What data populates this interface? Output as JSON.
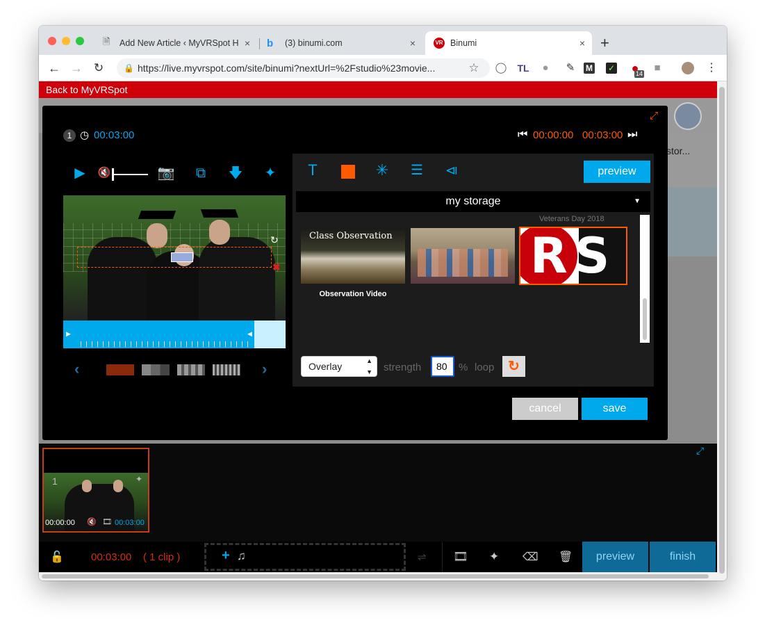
{
  "browser": {
    "tabs": [
      {
        "title": "Add New Article ‹ MyVRSpot H",
        "favicon": "document-icon"
      },
      {
        "title": "(3) binumi.com",
        "favicon": "binumi-b-icon"
      },
      {
        "title": "Binumi",
        "favicon": "vr-logo-icon"
      }
    ],
    "new_tab_label": "+",
    "url": "https://live.myvrspot.com/site/binumi?nextUrl=%2Fstudio%23movie...",
    "extension_badge": "14"
  },
  "page": {
    "back_link": "Back to MyVRSpot",
    "behind_text": "stor..."
  },
  "editor": {
    "clip_number": "1",
    "clip_duration": "00:03:00",
    "range_start": "00:00:00",
    "range_end": "00:03:00",
    "preview_label": "preview",
    "storage_label": "my storage",
    "thumbs": [
      {
        "title": "Class Observation",
        "caption": "Observation Video"
      },
      {
        "title": "",
        "caption": ""
      },
      {
        "title": "RS",
        "caption": "Veterans Day 2018"
      }
    ],
    "blend_mode": "Overlay",
    "strength_label": "strength",
    "strength_value": "80",
    "percent_label": "%",
    "loop_label": "loop",
    "cancel_label": "cancel",
    "save_label": "save"
  },
  "timeline": {
    "clip_number": "1",
    "clip_start": "00:00:00",
    "clip_end": "00:03:00",
    "total_time": "00:03:00",
    "clip_count": "( 1 clip )",
    "preview_label": "preview",
    "finish_label": "finish"
  },
  "colors": {
    "accent_blue": "#00a8ec",
    "accent_orange": "#ff5a00",
    "brand_red": "#d0000a"
  }
}
